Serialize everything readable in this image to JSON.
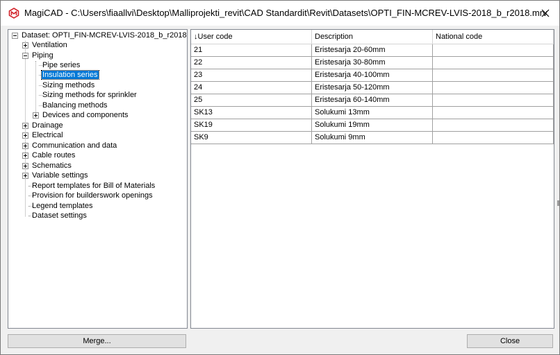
{
  "window": {
    "title": "MagiCAD - C:\\Users\\fiaallvi\\Desktop\\Malliprojekti_revit\\CAD Standardit\\Revit\\Datasets\\OPTI_FIN-MCREV-LVIS-2018_b_r2018.mrv",
    "close_glyph": "✕"
  },
  "tree": {
    "root": "Dataset: OPTI_FIN-MCREV-LVIS-2018_b_r2018",
    "ventilation": "Ventilation",
    "piping": "Piping",
    "pipe_series": "Pipe series",
    "insulation_series": "Insulation series",
    "sizing_methods": "Sizing methods",
    "sizing_sprinkler": "Sizing methods for sprinkler",
    "balancing_methods": "Balancing methods",
    "devices_components": "Devices and components",
    "drainage": "Drainage",
    "electrical": "Electrical",
    "communication": "Communication and data",
    "cable_routes": "Cable routes",
    "schematics": "Schematics",
    "variable_settings": "Variable settings",
    "report_templates": "Report templates for Bill of Materials",
    "provision": "Provision for builderswork openings",
    "legend_templates": "Legend templates",
    "dataset_settings": "Dataset settings"
  },
  "grid": {
    "sort_indicator": "↓",
    "columns": [
      "User code",
      "Description",
      "National code"
    ],
    "rows": [
      [
        "21",
        "Eristesarja 20-60mm",
        ""
      ],
      [
        "22",
        "Eristesarja 30-80mm",
        ""
      ],
      [
        "23",
        "Eristesarja 40-100mm",
        ""
      ],
      [
        "24",
        "Eristesarja 50-120mm",
        ""
      ],
      [
        "25",
        "Eristesarja 60-140mm",
        ""
      ],
      [
        "SK13",
        "Solukumi 13mm",
        ""
      ],
      [
        "SK19",
        "Solukumi 19mm",
        ""
      ],
      [
        "SK9",
        "Solukumi 9mm",
        ""
      ]
    ]
  },
  "buttons": {
    "merge": "Merge...",
    "close": "Close"
  }
}
